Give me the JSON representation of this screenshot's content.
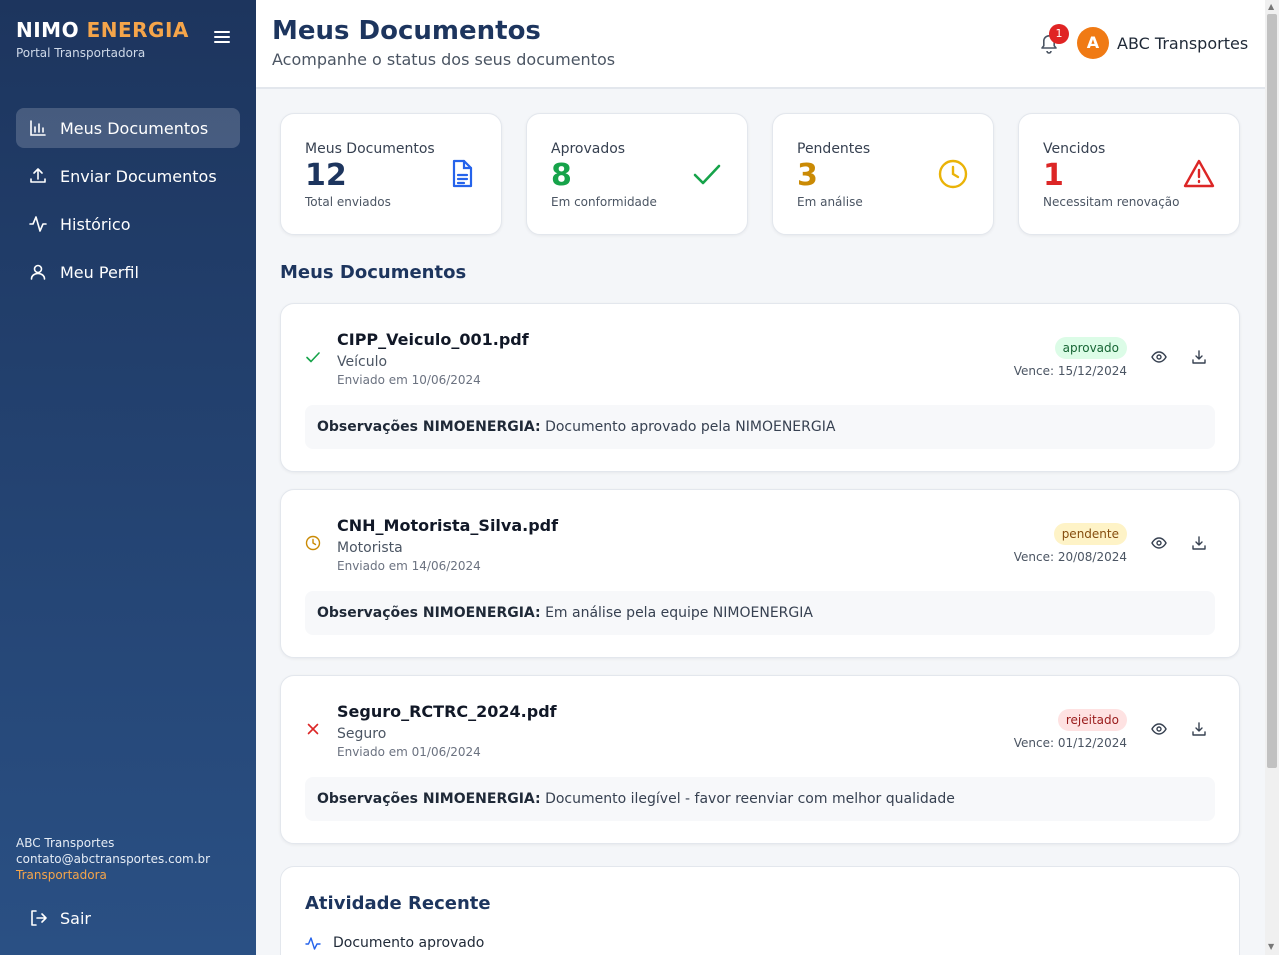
{
  "sidebar": {
    "brand_part1": "NIMO",
    "brand_part2": "ENERGIA",
    "brand_sub": "Portal Transportadora",
    "nav": [
      {
        "label": "Meus Documentos",
        "icon": "bar-chart-icon",
        "active": true
      },
      {
        "label": "Enviar Documentos",
        "icon": "upload-icon"
      },
      {
        "label": "Histórico",
        "icon": "activity-icon"
      },
      {
        "label": "Meu Perfil",
        "icon": "user-icon"
      }
    ],
    "user_name": "ABC Transportes",
    "user_email": "contato@abctransportes.com.br",
    "user_role": "Transportadora",
    "logout_label": "Sair"
  },
  "header": {
    "title": "Meus Documentos",
    "subtitle": "Acompanhe o status dos seus documentos",
    "notification_count": "1",
    "avatar_initial": "A",
    "company": "ABC Transportes"
  },
  "stats": [
    {
      "label": "Meus Documentos",
      "value": "12",
      "note": "Total enviados",
      "color": "#1d355e",
      "icon": "document-icon"
    },
    {
      "label": "Aprovados",
      "value": "8",
      "note": "Em conformidade",
      "color": "#16a34a",
      "icon": "check-icon"
    },
    {
      "label": "Pendentes",
      "value": "3",
      "note": "Em análise",
      "color": "#ca8a04",
      "icon": "clock-icon"
    },
    {
      "label": "Vencidos",
      "value": "1",
      "note": "Necessitam renovação",
      "color": "#dc2626",
      "icon": "warning-icon"
    }
  ],
  "section_title": "Meus Documentos",
  "documents": [
    {
      "name": "CIPP_Veiculo_001.pdf",
      "type": "Veículo",
      "sent": "Enviado em 10/06/2024",
      "status": "aprovado",
      "expiry": "Vence: 15/12/2024",
      "obs_label": "Observações NIMOENERGIA:",
      "obs_text": "Documento aprovado pela NIMOENERGIA"
    },
    {
      "name": "CNH_Motorista_Silva.pdf",
      "type": "Motorista",
      "sent": "Enviado em 14/06/2024",
      "status": "pendente",
      "expiry": "Vence: 20/08/2024",
      "obs_label": "Observações NIMOENERGIA:",
      "obs_text": "Em análise pela equipe NIMOENERGIA"
    },
    {
      "name": "Seguro_RCTRC_2024.pdf",
      "type": "Seguro",
      "sent": "Enviado em 01/06/2024",
      "status": "rejeitado",
      "expiry": "Vence: 01/12/2024",
      "obs_label": "Observações NIMOENERGIA:",
      "obs_text": "Documento ilegível - favor reenviar com melhor qualidade"
    }
  ],
  "activity": {
    "title": "Atividade Recente",
    "items": [
      {
        "label": "Documento aprovado",
        "icon": "activity-icon"
      }
    ]
  }
}
